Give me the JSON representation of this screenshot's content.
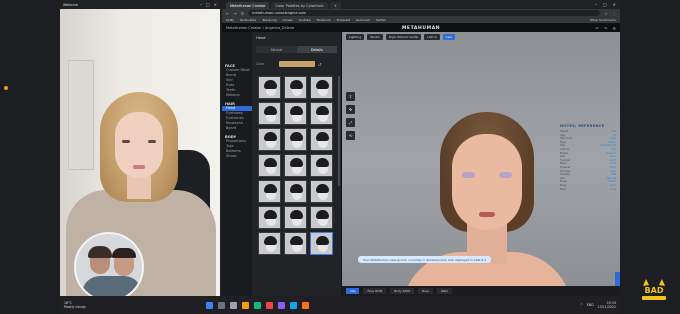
{
  "webcam": {
    "title": "Webcam"
  },
  "browser": {
    "tabs": [
      "MetaHuman Creator",
      "Color Palettes by ColorHunt"
    ],
    "url": "metahuman.unrealengine.com",
    "bookmarks": [
      "Sellfy",
      "Redbubble",
      "Teespring",
      "Unreal",
      "YouTube",
      "Facebook",
      "Pinterest",
      "Gumroad",
      "Twitter",
      "Other bookmarks"
    ]
  },
  "app": {
    "crumb": "MetaHuman Creator / Angelina_Dillane",
    "logo": "METAHUMAN",
    "sidebar": {
      "sections": [
        {
          "label": "FACE",
          "items": [
            "Custom Mesh",
            "Blend",
            "Skin",
            "Eyes",
            "Teeth",
            "Makeup"
          ]
        },
        {
          "label": "HAIR",
          "items": [
            "Head",
            "Eyebrows",
            "Eyelashes",
            "Mustache",
            "Beard"
          ]
        },
        {
          "label": "BODY",
          "items": [
            "Proportions",
            "Tops",
            "Bottoms",
            "Shoes"
          ]
        }
      ],
      "active_item": "Head"
    },
    "panel": {
      "title": "Head",
      "tabs": [
        "Strand",
        "Details"
      ],
      "active_tab": "Details",
      "tone_label": "Color",
      "tone_color": "#c8a26a"
    },
    "viewport": {
      "toolbar": [
        "Lighting",
        "Studio",
        "High (Strand Cards)",
        "LOD 0",
        "Cam"
      ],
      "accent_toolbar_index": 4,
      "tools": [
        "↕",
        "✥",
        "⤢",
        "⟲"
      ],
      "tooltip": "Your MetaHuman uses groom currently in development, look displayed in LOD 0-1",
      "timeline": [
        "Idle",
        "Face ROM",
        "Body ROM",
        "Pose",
        "Walk"
      ],
      "reference": {
        "title": "NOTES/ REFERENCE",
        "rows": [
          {
            "k": "Height",
            "v": "169"
          },
          {
            "k": "Age",
            "v": "24"
          },
          {
            "k": "Skin tone",
            "v": "Light"
          },
          {
            "k": "Eyes",
            "v": "Green"
          },
          {
            "k": "Hair",
            "v": "Dark Blonde"
          },
          {
            "k": "Lashes",
            "v": "Full"
          },
          {
            "k": "Brows",
            "v": "Natural"
          },
          {
            "k": "Lips",
            "v": "Rose"
          },
          {
            "k": "Freckles",
            "v": "Light"
          },
          {
            "k": "Blush",
            "v": "0.35"
          },
          {
            "k": "Eyeliner",
            "v": "Wing"
          },
          {
            "k": "Shadow",
            "v": "Lilac"
          },
          {
            "k": "Cheeks",
            "v": "Soft"
          },
          {
            "k": "Jaw",
            "v": "Narrow"
          },
          {
            "k": "Nose",
            "v": "Small"
          },
          {
            "k": "Body",
            "v": "Slim"
          },
          {
            "k": "Neck",
            "v": "Long"
          }
        ]
      }
    }
  },
  "taskbar": {
    "weather_temp": "16°C",
    "weather_desc": "Mostly cloudy",
    "lang": "ENG",
    "time": "15:34",
    "date": "13/11/2021"
  },
  "logo": {
    "text": "BAD",
    "color": "#f2c21b"
  }
}
